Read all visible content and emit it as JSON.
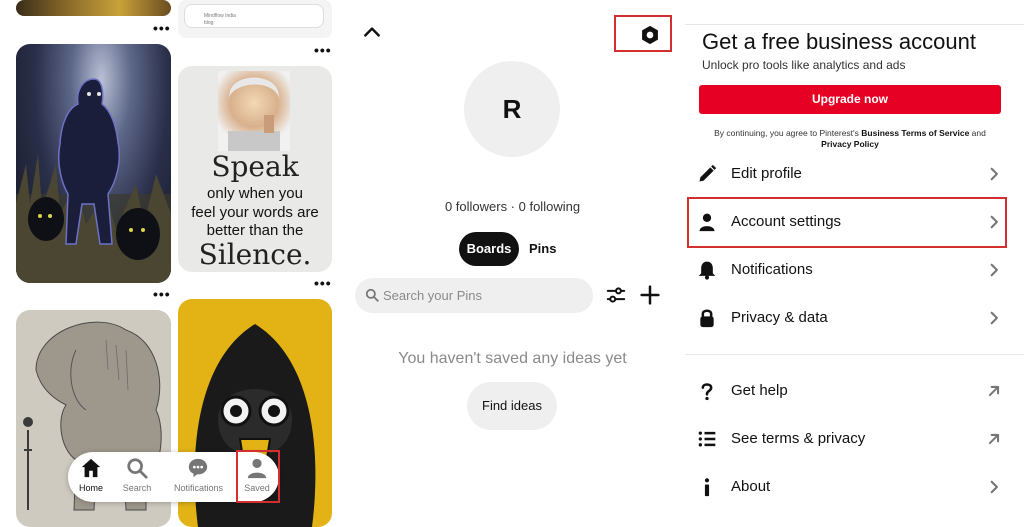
{
  "feed": {
    "mini_card_text": [
      "Mindflow India",
      "blog"
    ],
    "quote": {
      "line1": "Speak",
      "line2": "only when you",
      "line3": "feel your words are",
      "line4": "better than the",
      "line5": "Silence."
    },
    "more_label": "•••"
  },
  "bottom_nav": {
    "items": [
      {
        "label": "Home",
        "icon": "home-icon"
      },
      {
        "label": "Search",
        "icon": "search-icon"
      },
      {
        "label": "Notifications",
        "icon": "chat-bubble-icon"
      },
      {
        "label": "Saved",
        "icon": "person-icon"
      }
    ]
  },
  "profile": {
    "avatar_letter": "R",
    "followers_text": "0 followers · 0 following",
    "tabs": [
      "Boards",
      "Pins"
    ],
    "search_placeholder": "Search your Pins",
    "empty_message": "You haven't saved any ideas yet",
    "find_ideas_label": "Find ideas"
  },
  "settings": {
    "business_title": "Get a free business account",
    "business_subtitle": "Unlock pro tools like analytics and ads",
    "upgrade_label": "Upgrade now",
    "terms_prefix": "By continuing, you agree to Pinterest's ",
    "terms_link1": "Business Terms of Service",
    "terms_and": " and ",
    "terms_link2": "Privacy Policy",
    "rows_primary": [
      {
        "label": "Edit profile",
        "icon": "pencil-icon"
      },
      {
        "label": "Account settings",
        "icon": "person-icon"
      },
      {
        "label": "Notifications",
        "icon": "bell-icon"
      },
      {
        "label": "Privacy & data",
        "icon": "lock-icon"
      }
    ],
    "rows_secondary": [
      {
        "label": "Get help",
        "icon": "question-icon"
      },
      {
        "label": "See terms & privacy",
        "icon": "list-icon"
      },
      {
        "label": "About",
        "icon": "info-icon"
      }
    ]
  },
  "colors": {
    "brand_red": "#e60023",
    "highlight_red": "#d32f2f"
  }
}
